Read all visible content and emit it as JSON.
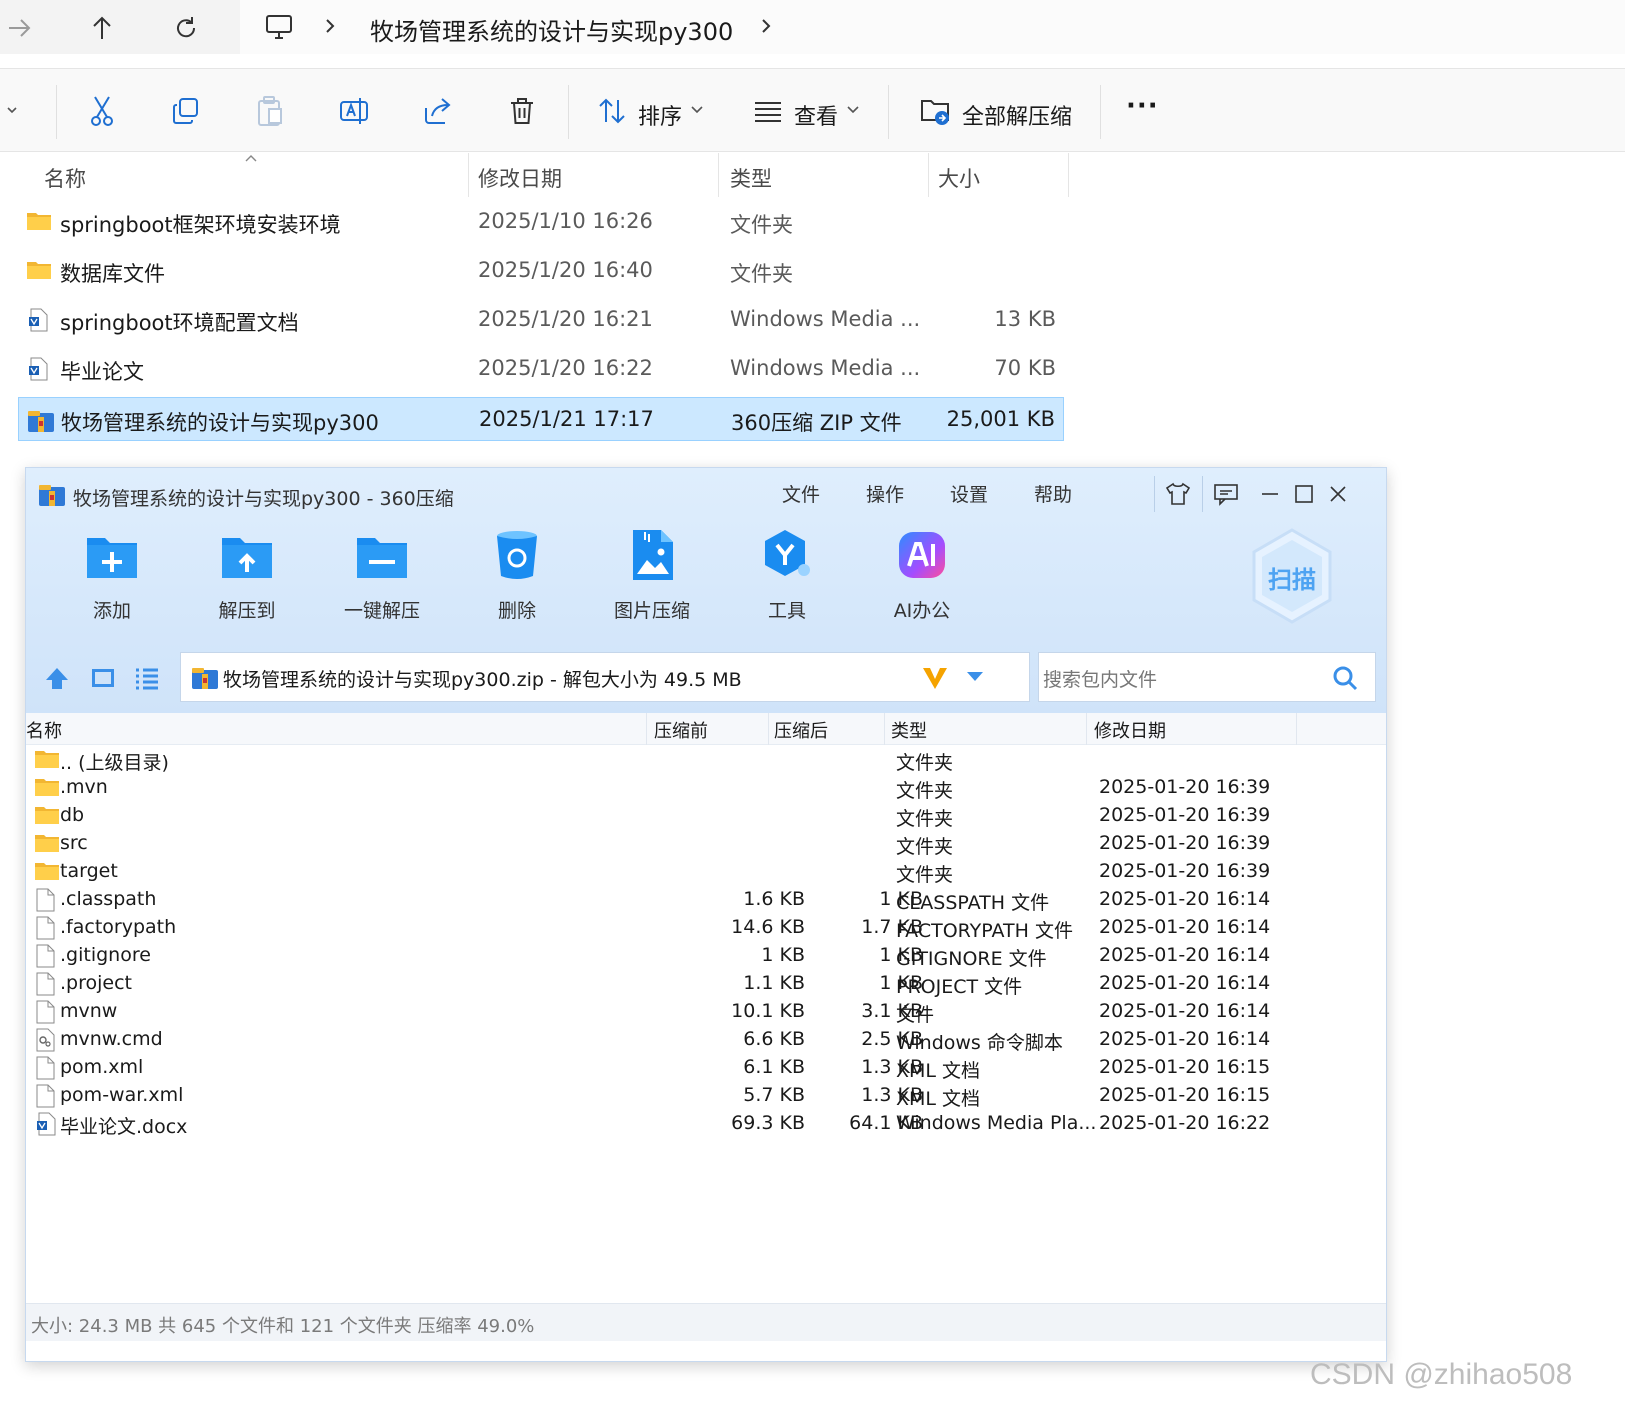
{
  "explorer": {
    "breadcrumb": "牧场管理系统的设计与实现py300",
    "toolbar": {
      "sort_label": "排序",
      "view_label": "查看",
      "extract_all_label": "全部解压缩",
      "more_label": "···"
    },
    "columns": {
      "name": "名称",
      "date": "修改日期",
      "type": "类型",
      "size": "大小"
    },
    "files": [
      {
        "name": "springboot框架环境安装环境",
        "date": "2025/1/10 16:26",
        "type": "文件夹",
        "size": "",
        "icon": "folder-icon"
      },
      {
        "name": "数据库文件",
        "date": "2025/1/20 16:40",
        "type": "文件夹",
        "size": "",
        "icon": "folder-icon"
      },
      {
        "name": "springboot环境配置文档",
        "date": "2025/1/20 16:21",
        "type": "Windows Media ...",
        "size": "13 KB",
        "icon": "doc-icon"
      },
      {
        "name": "毕业论文",
        "date": "2025/1/20 16:22",
        "type": "Windows Media ...",
        "size": "70 KB",
        "icon": "doc-icon"
      },
      {
        "name": "牧场管理系统的设计与实现py300",
        "date": "2025/1/21 17:17",
        "type": "360压缩 ZIP 文件",
        "size": "25,001 KB",
        "icon": "zip-icon",
        "selected": true
      }
    ]
  },
  "zipwin": {
    "title": "牧场管理系统的设计与实现py300 - 360压缩",
    "menu": [
      "文件",
      "操作",
      "设置",
      "帮助"
    ],
    "tools": [
      {
        "label": "添加",
        "icon": "add-icon"
      },
      {
        "label": "解压到",
        "icon": "extract-to-icon"
      },
      {
        "label": "一键解压",
        "icon": "one-click-extract-icon"
      },
      {
        "label": "删除",
        "icon": "delete-icon"
      },
      {
        "label": "图片压缩",
        "icon": "image-compress-icon"
      },
      {
        "label": "工具",
        "icon": "tools-icon"
      },
      {
        "label": "AI办公",
        "icon": "ai-office-icon"
      }
    ],
    "scan_label": "扫描",
    "path": "牧场管理系统的设计与实现py300.zip - 解包大小为 49.5 MB",
    "search_placeholder": "搜索包内文件",
    "columns": {
      "name": "名称",
      "before": "压缩前",
      "after": "压缩后",
      "type": "类型",
      "date": "修改日期"
    },
    "entries": [
      {
        "name": ".. (上级目录)",
        "before": "",
        "after": "",
        "type": "文件夹",
        "date": "",
        "icon": "folder-icon"
      },
      {
        "name": ".mvn",
        "before": "",
        "after": "",
        "type": "文件夹",
        "date": "2025-01-20 16:39",
        "icon": "folder-icon"
      },
      {
        "name": "db",
        "before": "",
        "after": "",
        "type": "文件夹",
        "date": "2025-01-20 16:39",
        "icon": "folder-icon"
      },
      {
        "name": "src",
        "before": "",
        "after": "",
        "type": "文件夹",
        "date": "2025-01-20 16:39",
        "icon": "folder-icon"
      },
      {
        "name": "target",
        "before": "",
        "after": "",
        "type": "文件夹",
        "date": "2025-01-20 16:39",
        "icon": "folder-icon"
      },
      {
        "name": ".classpath",
        "before": "1.6 KB",
        "after": "1 KB",
        "type": "CLASSPATH 文件",
        "date": "2025-01-20 16:14",
        "icon": "file-icon"
      },
      {
        "name": ".factorypath",
        "before": "14.6 KB",
        "after": "1.7 KB",
        "type": "FACTORYPATH 文件",
        "date": "2025-01-20 16:14",
        "icon": "file-icon"
      },
      {
        "name": ".gitignore",
        "before": "1 KB",
        "after": "1 KB",
        "type": "GITIGNORE 文件",
        "date": "2025-01-20 16:14",
        "icon": "file-icon"
      },
      {
        "name": ".project",
        "before": "1.1 KB",
        "after": "1 KB",
        "type": "PROJECT 文件",
        "date": "2025-01-20 16:14",
        "icon": "file-icon"
      },
      {
        "name": "mvnw",
        "before": "10.1 KB",
        "after": "3.1 KB",
        "type": "文件",
        "date": "2025-01-20 16:14",
        "icon": "file-icon"
      },
      {
        "name": "mvnw.cmd",
        "before": "6.6 KB",
        "after": "2.5 KB",
        "type": "Windows 命令脚本",
        "date": "2025-01-20 16:14",
        "icon": "cmd-file-icon"
      },
      {
        "name": "pom.xml",
        "before": "6.1 KB",
        "after": "1.3 KB",
        "type": "XML 文档",
        "date": "2025-01-20 16:15",
        "icon": "file-icon"
      },
      {
        "name": "pom-war.xml",
        "before": "5.7 KB",
        "after": "1.3 KB",
        "type": "XML 文档",
        "date": "2025-01-20 16:15",
        "icon": "file-icon"
      },
      {
        "name": "毕业论文.docx",
        "before": "69.3 KB",
        "after": "64.1 KB",
        "type": "Windows Media Pla...",
        "date": "2025-01-20 16:22",
        "icon": "doc-icon"
      }
    ],
    "status": "大小: 24.3 MB 共 645 个文件和 121 个文件夹 压缩率 49.0%"
  },
  "watermark": "CSDN @zhihao508"
}
